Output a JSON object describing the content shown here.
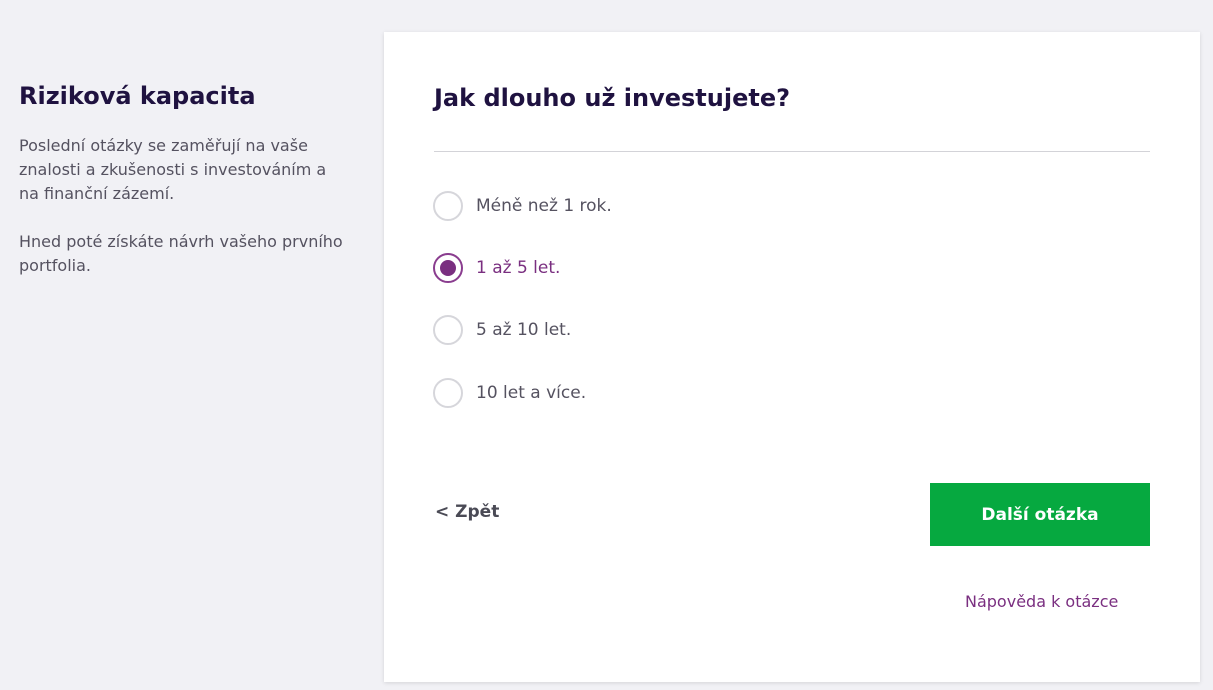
{
  "sidebar": {
    "title": "Riziková kapacita",
    "paragraph1": "Poslední otázky se zaměřují na vaše znalosti a zkušenosti s investováním a na finanční zázemí.",
    "paragraph2": "Hned poté získáte návrh vašeho prvního portfolia."
  },
  "question": {
    "title": "Jak dlouho už investujete?",
    "options": [
      {
        "label": "Méně než 1 rok.",
        "selected": false
      },
      {
        "label": "1 až 5 let.",
        "selected": true
      },
      {
        "label": "5 až 10 let.",
        "selected": false
      },
      {
        "label": "10 let a více.",
        "selected": false
      }
    ]
  },
  "navigation": {
    "back_label": "< Zpět",
    "next_label": "Další otázka",
    "help_label": "Nápověda k otázce"
  },
  "colors": {
    "accent": "#7a2f80",
    "primary_button": "#06a940",
    "heading": "#1f1240"
  }
}
